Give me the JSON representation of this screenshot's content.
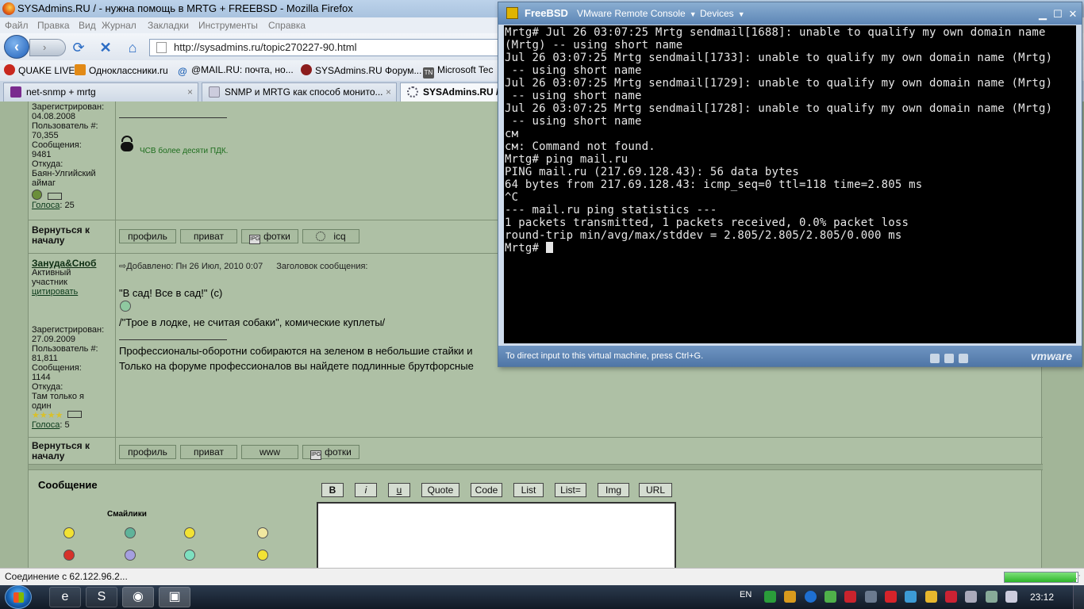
{
  "firefox": {
    "title": "SYSAdmins.RU / - нужна помощь в MRTG + FREEBSD - Mozilla Firefox",
    "menu": [
      "Файл",
      "Правка",
      "Вид",
      "Журнал",
      "Закладки",
      "Инструменты",
      "Справка"
    ],
    "url": "http://sysadmins.ru/topic270227-90.html",
    "bookmarks": [
      "QUAKE LIVE",
      "Одноклассники.ru",
      "@MAIL.RU: почта, но...",
      "SYSAdmins.RU Форум...",
      "Microsoft Tec"
    ],
    "tabs": [
      {
        "label": "net-snmp + mrtg",
        "close": "×"
      },
      {
        "label": "SNMP и MRTG как способ монито...",
        "close": "×"
      },
      {
        "label": "SYSAdmins.RU /",
        "close": ""
      }
    ],
    "status": "Соединение с 62.122.96.2...",
    "progress_fraction": 0.98
  },
  "forum": {
    "post1": {
      "registered_label": "Зарегистрирован:",
      "registered": "04.08.2008",
      "user_num_label": "Пользователь #:",
      "user_num": "70,355",
      "messages_label": "Сообщения:",
      "messages": "9481",
      "from_label": "Откуда:",
      "from": "Баян-Улгийский аймаг",
      "votes_label": "Голоса",
      "votes": ": 25",
      "signature": "ЧСВ более десяти ПДК."
    },
    "back_to_top": "Вернуться к началу",
    "buttons1": [
      "профиль",
      "приват",
      "фотки",
      "icq"
    ],
    "post2": {
      "author": "Зануда&Сноб",
      "rank": "Активный участник",
      "quote_link": "цитировать",
      "added": "Добавлено: Пн 26 Июл, 2010 0:07",
      "subject_label": "Заголовок сообщения:",
      "line1": "\"В сад! Все в сад!\" (с)",
      "line2": "/\"Трое в лодке, не считая собаки\", комические куплеты/",
      "line3": "Профессионалы-оборотни собираются на зеленом в небольшие стайки и",
      "line4": "Только на форуме профессионалов вы найдете подлинные брутфорсные",
      "registered_label": "Зарегистрирован:",
      "registered": "27.09.2009",
      "user_num_label": "Пользователь #:",
      "user_num": "81,811",
      "messages_label": "Сообщения:",
      "messages": "1144",
      "from_label": "Откуда:",
      "from": "Там только я один",
      "votes_label": "Голоса",
      "votes": ": 5"
    },
    "buttons2": [
      "профиль",
      "приват",
      "www",
      "фотки"
    ],
    "reply": {
      "message_label": "Сообщение",
      "smilies_label": "Смайлики",
      "editor_buttons": [
        "B",
        "i",
        "u",
        "Quote",
        "Code",
        "List",
        "List=",
        "Img",
        "URL"
      ]
    }
  },
  "vmware": {
    "host": "FreeBSD",
    "app": "VMware Remote Console",
    "devices": "Devices",
    "terminal_lines": [
      "Mrtg# Jul 26 03:07:25 Mrtg sendmail[1688]: unable to qualify my own domain name",
      "(Mrtg) -- using short name",
      "Jul 26 03:07:25 Mrtg sendmail[1733]: unable to qualify my own domain name (Mrtg)",
      " -- using short name",
      "Jul 26 03:07:25 Mrtg sendmail[1729]: unable to qualify my own domain name (Mrtg)",
      " -- using short name",
      "Jul 26 03:07:25 Mrtg sendmail[1728]: unable to qualify my own domain name (Mrtg)",
      " -- using short name",
      "см",
      "см: Command not found.",
      "Mrtg# ping mail.ru",
      "PING mail.ru (217.69.128.43): 56 data bytes",
      "64 bytes from 217.69.128.43: icmp_seq=0 ttl=118 time=2.805 ms",
      "^C",
      "--- mail.ru ping statistics ---",
      "1 packets transmitted, 1 packets received, 0.0% packet loss",
      "round-trip min/avg/max/stddev = 2.805/2.805/2.805/0.000 ms"
    ],
    "prompt": "Mrtg# ",
    "hint": "To direct input to this virtual machine, press Ctrl+G.",
    "brand": "vmware"
  },
  "taskbar": {
    "lang": "EN",
    "clock": "23:12"
  },
  "colors": {
    "forum_bg": "#aec0a5",
    "terminal_bg": "#000000",
    "terminal_fg": "#e6e6e6"
  }
}
